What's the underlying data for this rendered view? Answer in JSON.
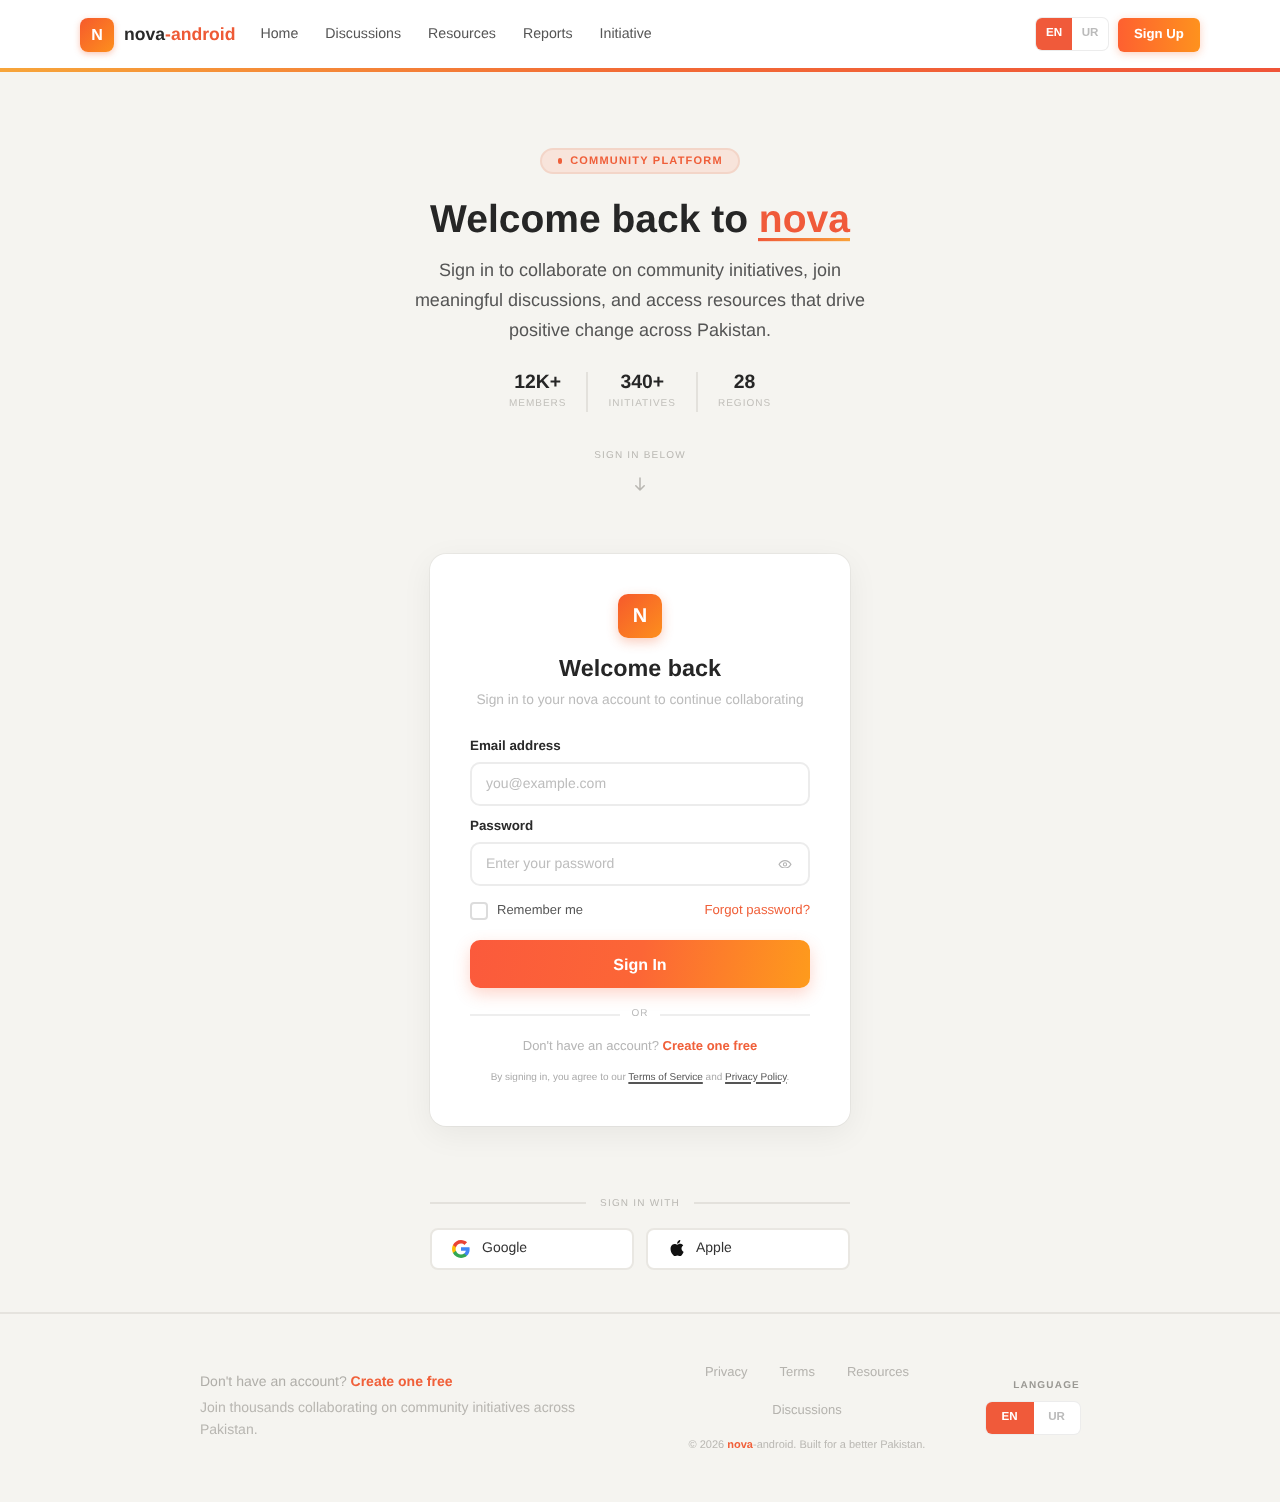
{
  "nav": {
    "logo_letter": "N",
    "brand": "nova",
    "brand_suffix": "-android",
    "links": [
      "Home",
      "Discussions",
      "Resources",
      "Reports",
      "Initiative"
    ],
    "language": [
      {
        "label": "EN",
        "selected": true
      },
      {
        "label": "UR",
        "selected": false
      }
    ],
    "signup_button": "Sign Up"
  },
  "hero": {
    "badge": "COMMUNITY PLATFORM",
    "title": "Welcome back to",
    "title_highlight": "nova",
    "description": "Sign in to collaborate on community initiatives, join meaningful discussions, and access resources that drive positive change across Pakistan.",
    "stats": [
      {
        "value": "12K+",
        "label": "MEMBERS"
      },
      {
        "value": "340+",
        "label": "INITIATIVES"
      },
      {
        "value": "28",
        "label": "REGIONS"
      }
    ],
    "scroll_hint": "SIGN IN BELOW"
  },
  "card": {
    "logo_letter": "N",
    "title": "Welcome back",
    "subtitle": "Sign in to your nova account to continue collaborating",
    "fields": [
      {
        "kind": "email",
        "label": "Email address",
        "placeholder": "you@example.com"
      },
      {
        "kind": "password",
        "label": "Password",
        "placeholder": "Enter your password"
      }
    ],
    "remember": {
      "label": "Remember me",
      "checked": false
    },
    "forgot_link": "Forgot password?",
    "submit_button": "Sign In",
    "divider": "OR",
    "signup_prompt": "Don't have an account?",
    "signup_link": "Create one free",
    "terms": [
      {
        "kind": "text",
        "text": "By signing in, you agree to our "
      },
      {
        "kind": "link",
        "text": "Terms of Service"
      },
      {
        "kind": "text",
        "text": " and "
      },
      {
        "kind": "link",
        "text": "Privacy Policy"
      },
      {
        "kind": "text",
        "text": "."
      }
    ]
  },
  "social": {
    "heading": "SIGN IN WITH",
    "buttons": [
      {
        "kind": "google",
        "label": "Google"
      },
      {
        "kind": "apple",
        "label": "Apple"
      }
    ]
  },
  "footer": {
    "signup_prompt": "Don't have an account?",
    "signup_link": "Create one free",
    "description": "Join thousands collaborating on community initiatives across Pakistan.",
    "links": [
      "Privacy",
      "Terms",
      "Resources",
      "Discussions"
    ],
    "copyright": "© 2026 **nova**-android. Built for a better Pakistan.",
    "language_heading": "LANGUAGE",
    "language": [
      {
        "label": "EN",
        "selected": true
      },
      {
        "label": "UR",
        "selected": false
      }
    ]
  }
}
